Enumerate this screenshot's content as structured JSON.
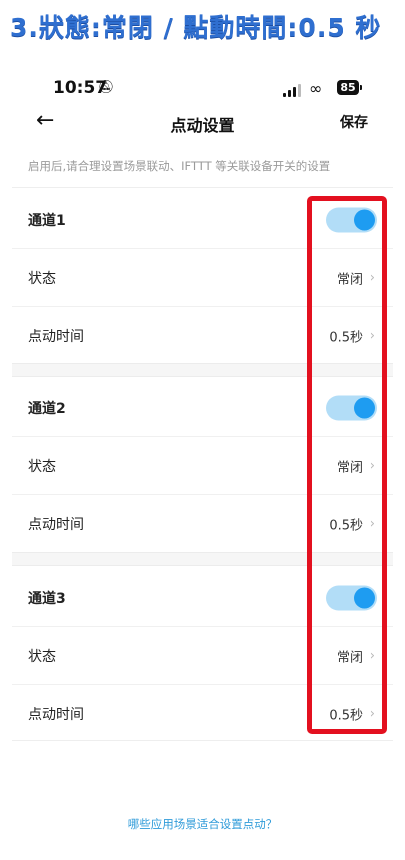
{
  "banner": {
    "text": "3.狀態:常閉 / 點動時間:0.5 秒"
  },
  "status_bar": {
    "time": "10:57",
    "battery": "85",
    "icons": [
      "bell-mute-icon",
      "signal-icon",
      "link-icon",
      "battery-icon"
    ]
  },
  "nav": {
    "back_icon": "back-arrow-icon",
    "title": "点动设置",
    "save_label": "保存"
  },
  "hint": "启用后,请合理设置场景联动、IFTTT 等关联设备开关的设置",
  "channels": [
    {
      "name": "通道1",
      "enabled": true,
      "status_label": "状态",
      "status_value": "常闭",
      "time_label": "点动时间",
      "time_value": "0.5秒"
    },
    {
      "name": "通道2",
      "enabled": true,
      "status_label": "状态",
      "status_value": "常闭",
      "time_label": "点动时间",
      "time_value": "0.5秒"
    },
    {
      "name": "通道3",
      "enabled": true,
      "status_label": "状态",
      "status_value": "常闭",
      "time_label": "点动时间",
      "time_value": "0.5秒"
    }
  ],
  "footer_link": "哪些应用场景适合设置点动？",
  "colors": {
    "banner": "#2f6fd0",
    "toggle_track": "#b2ddf7",
    "toggle_knob": "#1e9cf1",
    "highlight": "#e3101f",
    "link": "#2f9bd9"
  }
}
